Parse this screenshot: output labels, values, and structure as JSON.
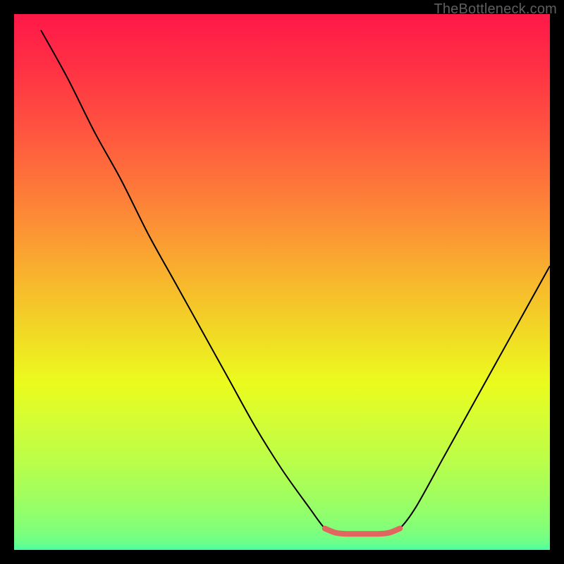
{
  "watermark": {
    "text": "TheBottleneck.com"
  },
  "gradient": {
    "stops": [
      {
        "offset": 0.0,
        "hex": "#ff1948"
      },
      {
        "offset": 0.03,
        "hex": "#ff1f47"
      },
      {
        "offset": 0.06,
        "hex": "#ff2746"
      },
      {
        "offset": 0.09,
        "hex": "#ff2e45"
      },
      {
        "offset": 0.12,
        "hex": "#ff3744"
      },
      {
        "offset": 0.15,
        "hex": "#ff4042"
      },
      {
        "offset": 0.18,
        "hex": "#ff4941"
      },
      {
        "offset": 0.21,
        "hex": "#ff5240"
      },
      {
        "offset": 0.24,
        "hex": "#ff5c3e"
      },
      {
        "offset": 0.27,
        "hex": "#fe663d"
      },
      {
        "offset": 0.3,
        "hex": "#fe703b"
      },
      {
        "offset": 0.33,
        "hex": "#fd7a39"
      },
      {
        "offset": 0.36,
        "hex": "#fd8537"
      },
      {
        "offset": 0.39,
        "hex": "#fc8f35"
      },
      {
        "offset": 0.42,
        "hex": "#fb9a33"
      },
      {
        "offset": 0.45,
        "hex": "#faa531"
      },
      {
        "offset": 0.48,
        "hex": "#f8b02e"
      },
      {
        "offset": 0.51,
        "hex": "#f7bb2c"
      },
      {
        "offset": 0.54,
        "hex": "#f5c529"
      },
      {
        "offset": 0.57,
        "hex": "#f3d027"
      },
      {
        "offset": 0.6,
        "hex": "#f1db24"
      },
      {
        "offset": 0.63,
        "hex": "#efe622"
      },
      {
        "offset": 0.66,
        "hex": "#edf120"
      },
      {
        "offset": 0.69,
        "hex": "#eafb1e"
      },
      {
        "offset": 0.72,
        "hex": "#e1fc27"
      },
      {
        "offset": 0.75,
        "hex": "#d7fd31"
      },
      {
        "offset": 0.78,
        "hex": "#cdfd3a"
      },
      {
        "offset": 0.81,
        "hex": "#c3fd42"
      },
      {
        "offset": 0.84,
        "hex": "#b8fe4b"
      },
      {
        "offset": 0.87,
        "hex": "#acfe55"
      },
      {
        "offset": 0.9,
        "hex": "#a0fe5f"
      },
      {
        "offset": 0.93,
        "hex": "#92ff6b"
      },
      {
        "offset": 0.955,
        "hex": "#85ff76"
      },
      {
        "offset": 0.975,
        "hex": "#77ff82"
      },
      {
        "offset": 0.988,
        "hex": "#68ff8c"
      },
      {
        "offset": 0.996,
        "hex": "#55ff99"
      },
      {
        "offset": 1.0,
        "hex": "#40ffa7"
      }
    ]
  },
  "chart_data": {
    "type": "line",
    "title": "",
    "xlabel": "",
    "ylabel": "",
    "xlim": [
      0,
      100
    ],
    "ylim": [
      0,
      100
    ],
    "series": [
      {
        "name": "bottleneck-curve",
        "color": "#000000",
        "values": [
          {
            "x": 5,
            "y": 97
          },
          {
            "x": 10,
            "y": 88
          },
          {
            "x": 15,
            "y": 78
          },
          {
            "x": 20,
            "y": 69
          },
          {
            "x": 25,
            "y": 59
          },
          {
            "x": 30,
            "y": 50
          },
          {
            "x": 35,
            "y": 41
          },
          {
            "x": 40,
            "y": 32
          },
          {
            "x": 45,
            "y": 23
          },
          {
            "x": 50,
            "y": 15
          },
          {
            "x": 55,
            "y": 8
          },
          {
            "x": 58,
            "y": 4
          },
          {
            "x": 60,
            "y": 3
          },
          {
            "x": 65,
            "y": 3
          },
          {
            "x": 70,
            "y": 3
          },
          {
            "x": 72,
            "y": 4
          },
          {
            "x": 75,
            "y": 8
          },
          {
            "x": 80,
            "y": 17
          },
          {
            "x": 85,
            "y": 26
          },
          {
            "x": 90,
            "y": 35
          },
          {
            "x": 95,
            "y": 44
          },
          {
            "x": 100,
            "y": 53
          }
        ]
      },
      {
        "name": "floor-marker",
        "color": "#e26660",
        "values": [
          {
            "x": 58,
            "y": 4
          },
          {
            "x": 60,
            "y": 3.2
          },
          {
            "x": 62,
            "y": 3
          },
          {
            "x": 65,
            "y": 3
          },
          {
            "x": 68,
            "y": 3
          },
          {
            "x": 70,
            "y": 3.2
          },
          {
            "x": 72,
            "y": 4
          }
        ]
      }
    ]
  }
}
